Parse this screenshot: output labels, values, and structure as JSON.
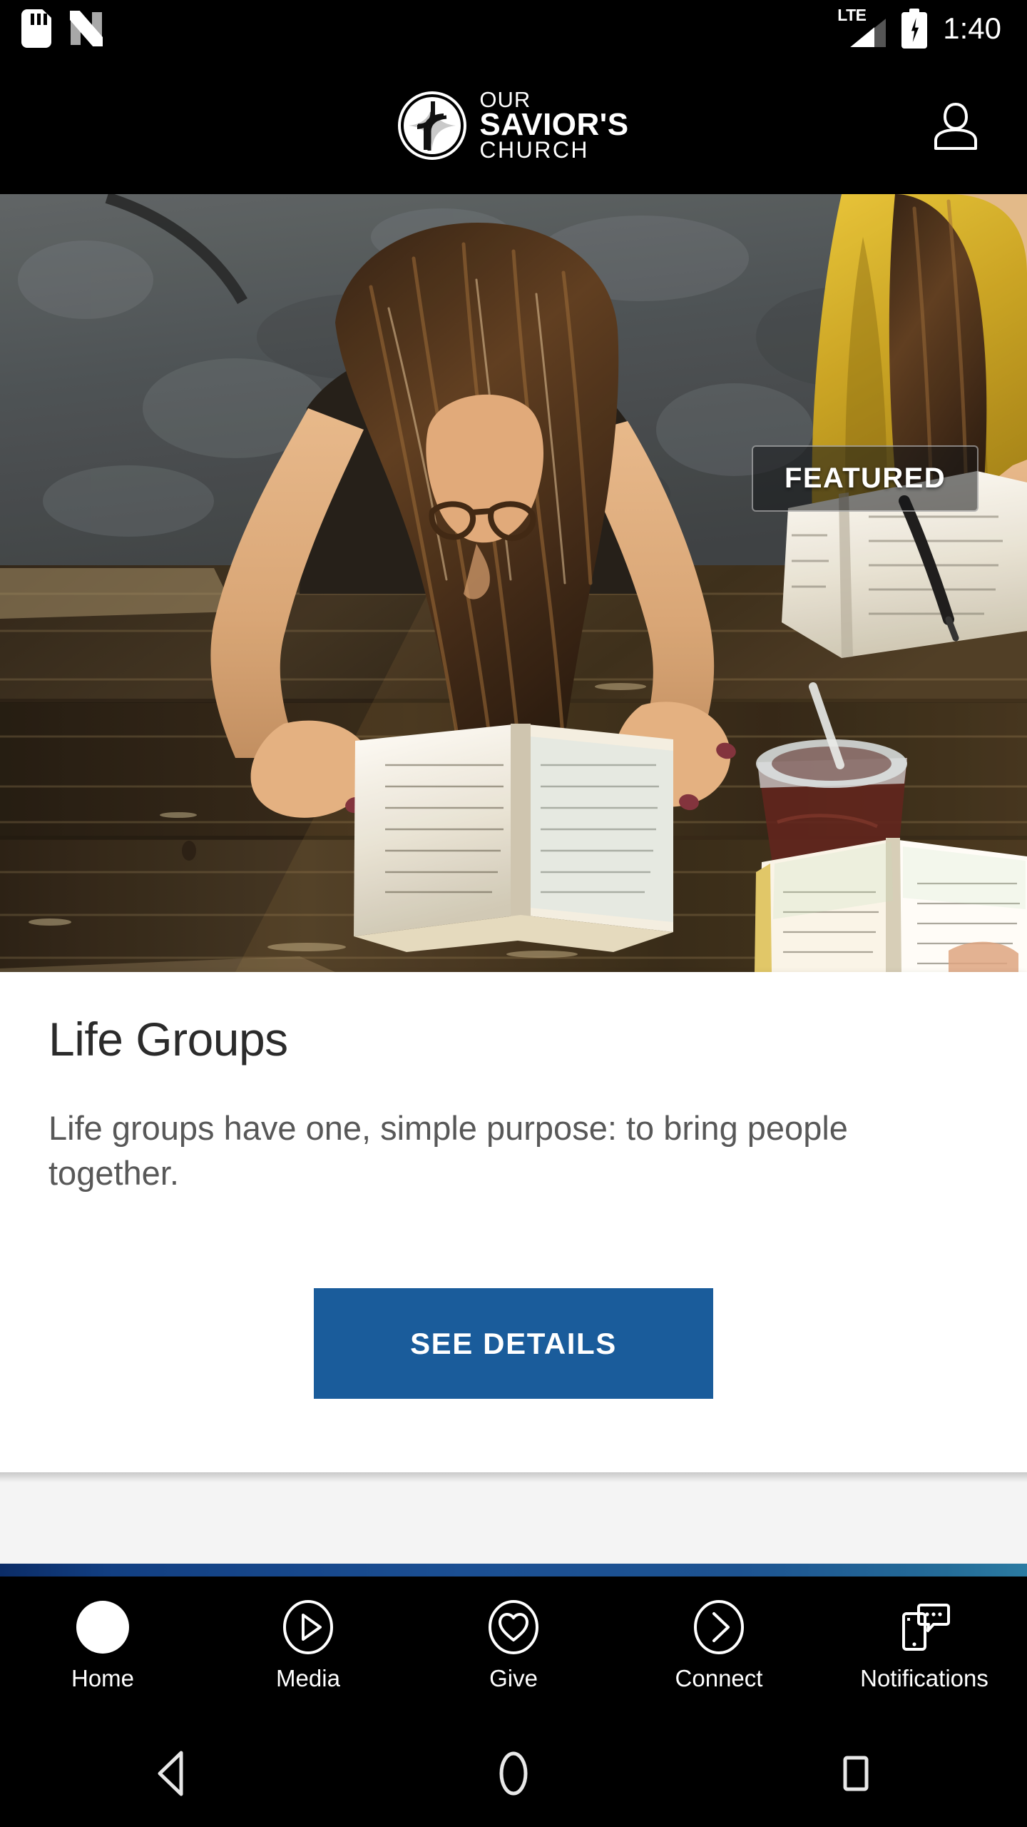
{
  "status_bar": {
    "icons": [
      "sd-card-icon",
      "android-nougat-icon"
    ],
    "network_label": "LTE",
    "battery_state": "charging",
    "time": "1:40"
  },
  "app_header": {
    "logo": {
      "icon": "church-cross-emblem-icon",
      "line1": "OUR",
      "line2": "SAVIOR'S",
      "line3": "CHURCH"
    },
    "profile_icon": "person-icon"
  },
  "hero": {
    "alt": "Two women studying books at a weathered wooden picnic table outdoors",
    "badge_label": "FEATURED"
  },
  "card": {
    "title": "Life Groups",
    "description": "Life groups have one, simple purpose: to bring people together.",
    "cta_label": "SEE DETAILS",
    "cta_color": "#1a5c9b"
  },
  "tab_bar": {
    "items": [
      {
        "label": "Home",
        "icon": "filled-circle-icon",
        "active": true
      },
      {
        "label": "Media",
        "icon": "play-circle-icon",
        "active": false
      },
      {
        "label": "Give",
        "icon": "heart-circle-icon",
        "active": false
      },
      {
        "label": "Connect",
        "icon": "chevron-right-circle-icon",
        "active": false
      },
      {
        "label": "Notifications",
        "icon": "phone-message-icon",
        "active": false
      }
    ],
    "accent_gradient": [
      "#0b2c66",
      "#1b4f93",
      "#2b7ba2"
    ]
  },
  "system_nav": {
    "back": "back-triangle-icon",
    "home": "home-circle-icon",
    "recents": "recents-square-icon"
  }
}
